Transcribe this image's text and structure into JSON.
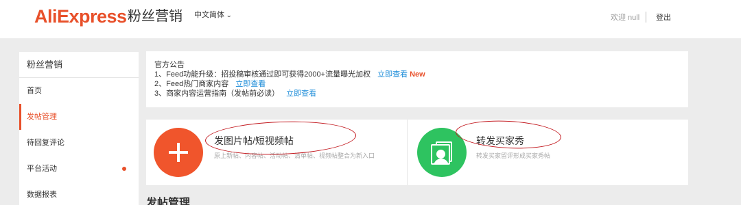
{
  "header": {
    "logo": "AliExpress",
    "logo_tm": "®",
    "product": "粉丝营销",
    "language": "中文简体",
    "welcome": "欢迎 null",
    "logout": "登出"
  },
  "sidebar": {
    "title": "粉丝营销",
    "items": [
      {
        "label": "首页"
      },
      {
        "label": "发帖管理"
      },
      {
        "label": "待回复评论"
      },
      {
        "label": "平台活动"
      },
      {
        "label": "数据报表"
      }
    ]
  },
  "notice": {
    "title": "官方公告",
    "lines": [
      {
        "text": "1、Feed功能升级：招投稿审核通过即可获得2000+流量曝光加权",
        "link": "立即查看",
        "badge": "New"
      },
      {
        "text": "2、Feed热门商家内容",
        "link": "立即查看"
      },
      {
        "text": "3、商家内容运营指南（发帖前必读）",
        "link": "立即查看"
      }
    ]
  },
  "cards": [
    {
      "title": "发图片帖/短视频帖",
      "desc": "原上新帖、内容帖、活动帖、清单帖、视频帖整合为新入口",
      "icon": "plus-icon",
      "color": "#f0552c"
    },
    {
      "title": "转发买家秀",
      "desc": "转发买家留评形成买家秀帖",
      "icon": "buyer-show-icon",
      "color": "#2ec360"
    }
  ],
  "section": {
    "title": "发帖管理"
  },
  "colors": {
    "accent": "#e8502a",
    "link": "#1a8bd8",
    "annotation": "#c2171d"
  }
}
